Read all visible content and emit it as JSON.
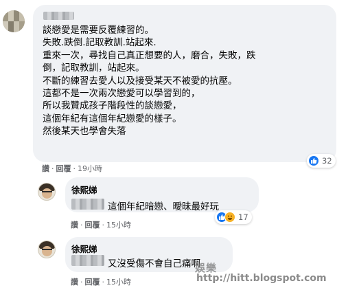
{
  "main_comment": {
    "author": "",
    "lines": [
      "談戀愛是需要反覆練習的。",
      "失敗.跌倒.記取教訓.站起來.",
      "重來一次，尋找自己真正想要的人，磨合，失敗，跌",
      "倒，記取教訓，站起來。",
      "不斷的練習去愛人以及接受某天不被愛的抗壓。",
      "這都不是一次兩次戀愛可以學習到的，",
      "所以我贊成孩子階段性的談戀愛，",
      "這個年紀有這個年紀戀愛的樣子。",
      "然後某天也學會失落"
    ],
    "actions": {
      "like": "讚",
      "reply": "回覆",
      "separator": "·",
      "time": "19小時"
    },
    "reactions": {
      "icons": [
        "like-icon"
      ],
      "count": "32"
    }
  },
  "replies": [
    {
      "author": "徐熙娣",
      "text": "這個年紀暗戀、曖昧最好玩",
      "actions": {
        "like": "讚",
        "reply": "回覆",
        "separator": "·",
        "time": "15小時"
      },
      "reactions": {
        "icons": [
          "like-icon",
          "haha-icon"
        ],
        "count": "17"
      }
    },
    {
      "author": "徐熙娣",
      "text": "又沒受傷不會自己痛啊",
      "actions": {
        "like": "讚",
        "reply": "回覆",
        "separator": "·",
        "time": "15小時"
      }
    }
  ],
  "watermark": {
    "logo": "娛樂",
    "url": "http://hitt.blogspot.com"
  },
  "colors": {
    "bubble": "#f0f2f5",
    "like_blue": "#1877f2",
    "haha_yellow": "#f7b125",
    "meta_gray": "#65676b"
  }
}
